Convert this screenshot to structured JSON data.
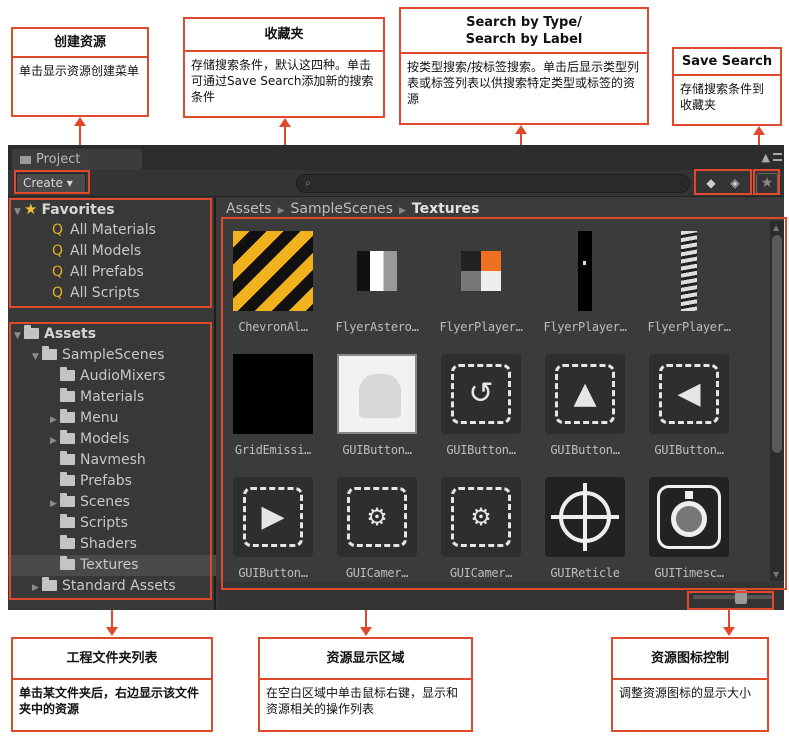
{
  "callouts": {
    "create_asset": {
      "title": "创建资源",
      "body": "单击显示资源创建菜单"
    },
    "favorites": {
      "title": "收藏夹",
      "body": "存储搜索条件，默认这四种。单击可通过Save Search添加新的搜索条件"
    },
    "search_type": {
      "title_line1": "Search by Type/",
      "title_line2": "Search by Label",
      "body": "按类型搜索/按标签搜索。单击后显示类型列表或标签列表以供搜索特定类型或标签的资源"
    },
    "save_search": {
      "title": "Save Search",
      "body": "存储搜索条件到收藏夹"
    },
    "folder_list": {
      "title": "工程文件夹列表",
      "body": "单击某文件夹后，右边显示该文件夹中的资源"
    },
    "asset_area": {
      "title": "资源显示区域",
      "body": "在空白区域中单击鼠标右键，显示和资源相关的操作列表"
    },
    "icon_control": {
      "title": "资源图标控制",
      "body": "调整资源图标的显示大小"
    }
  },
  "window": {
    "tab_label": "Project",
    "create_label": "Create ▾",
    "search_placeholder": "🔍",
    "star_glyph": "★",
    "lock_glyph": "🔒"
  },
  "favorites": {
    "header": "Favorites",
    "items": [
      "All Materials",
      "All Models",
      "All Prefabs",
      "All Scripts"
    ]
  },
  "tree": {
    "assets": "Assets",
    "sample_scenes": "SampleScenes",
    "children": [
      "AudioMixers",
      "Materials",
      "Menu",
      "Models",
      "Navmesh",
      "Prefabs",
      "Scenes",
      "Scripts",
      "Shaders",
      "Textures"
    ],
    "standard_assets": "Standard Assets"
  },
  "breadcrumb": {
    "part1": "Assets",
    "part2": "SampleScenes",
    "part3": "Textures"
  },
  "assets": [
    {
      "label": "ChevronAl…",
      "kind": "chevron"
    },
    {
      "label": "FlyerAstero…",
      "kind": "flyer-astero"
    },
    {
      "label": "FlyerPlayer…",
      "kind": "flyer-player-color"
    },
    {
      "label": "FlyerPlayer…",
      "kind": "flyer-player-strip1"
    },
    {
      "label": "FlyerPlayer…",
      "kind": "flyer-player-strip2"
    },
    {
      "label": "GridEmissi…",
      "kind": "grid-emissive"
    },
    {
      "label": "GUIButton…",
      "kind": "gui-button-blank"
    },
    {
      "label": "GUIButton…",
      "kind": "gui-button-rotate"
    },
    {
      "label": "GUIButton…",
      "kind": "gui-button-up"
    },
    {
      "label": "GUIButton…",
      "kind": "gui-button-left"
    },
    {
      "label": "GUIButton…",
      "kind": "gui-button-play"
    },
    {
      "label": "GUICamer…",
      "kind": "gui-camera"
    },
    {
      "label": "GUICamer…",
      "kind": "gui-camera-2"
    },
    {
      "label": "GUIReticle",
      "kind": "gui-reticle"
    },
    {
      "label": "GUITimesc…",
      "kind": "gui-timescale"
    }
  ],
  "colors": {
    "accent": "#e04a2c",
    "panel": "#3a3a3a",
    "favorite_star": "#f0c030"
  }
}
